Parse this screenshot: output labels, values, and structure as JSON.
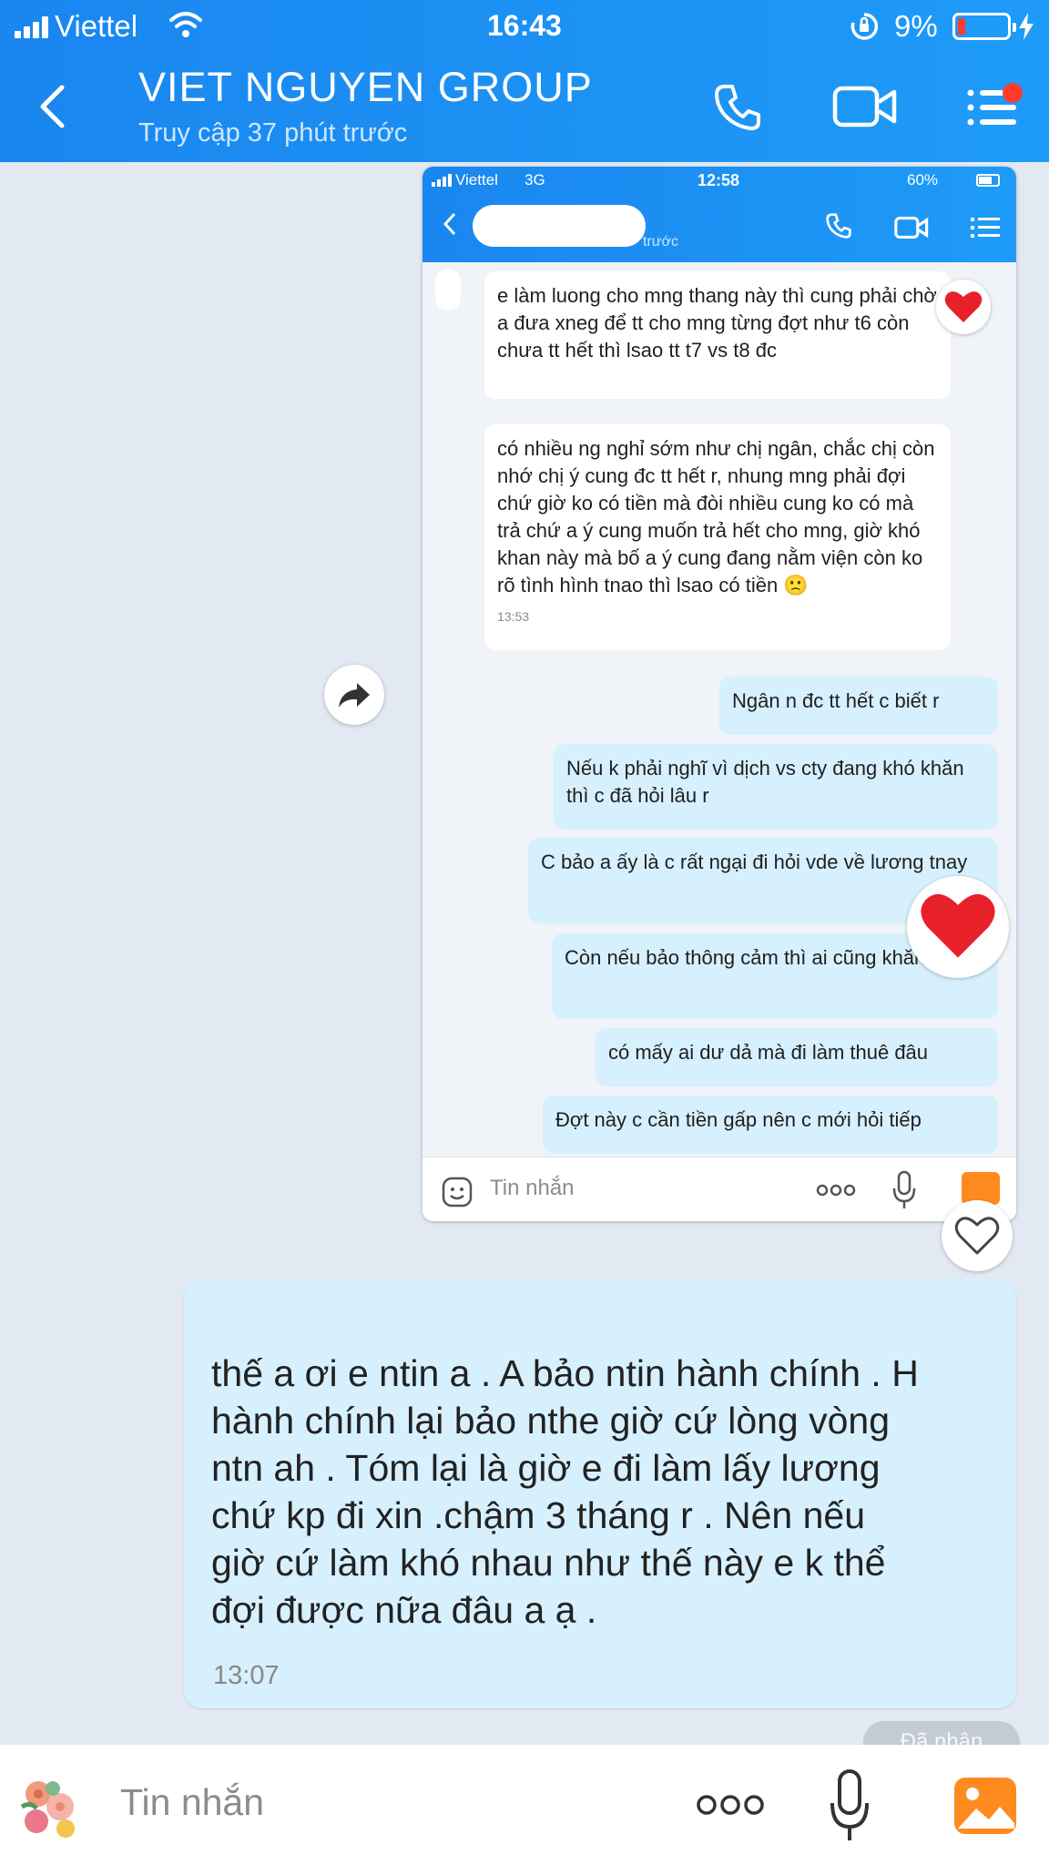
{
  "status": {
    "carrier": "Viettel",
    "time": "16:43",
    "battery": "9%"
  },
  "header": {
    "title": "VIET NGUYEN GROUP",
    "subtitle": "Truy cập 37 phút trước"
  },
  "embedded": {
    "status": {
      "carrier": "Viettel",
      "network": "3G",
      "time": "12:58",
      "battery": "60%"
    },
    "header_subtitle_visible": "trước",
    "messages": [
      {
        "side": "in",
        "text": "e làm luong cho mng thang này thì cung phải chờ a đưa xneg để tt cho mng từng đợt như t6 còn chưa tt hết thì lsao tt t7 vs t8 đc"
      },
      {
        "side": "in",
        "text": "có nhiều ng nghỉ sớm như chị ngân, chắc chị còn nhớ chị ý cung đc tt hết r, nhung mng phải đợi chứ giờ ko có tiền mà đòi nhiều cung ko có mà trả chứ a ý cung muốn trả hết cho mng, giờ khó khan này mà bố a ý cung đang nằm viện còn ko rõ tình hình tnao thì lsao có tiền 🙁",
        "time": "13:53"
      },
      {
        "side": "out",
        "text": "Ngân n đc tt hết c biết r"
      },
      {
        "side": "out",
        "text": "Nếu k phải nghĩ vì dịch vs cty đang khó khăn thì c đã hỏi lâu r"
      },
      {
        "side": "out",
        "text": "C bảo a ấy là c rất ngại đi hỏi vde về lương tnay"
      },
      {
        "side": "out",
        "text": "Còn nếu bảo thông cảm thì ai cũng khăn hết"
      },
      {
        "side": "out",
        "text": "có mấy ai dư dả mà đi làm thuê đâu"
      },
      {
        "side": "out",
        "text": "Đợt này c cần tiền gấp nên c mới hỏi tiếp"
      }
    ],
    "input_placeholder": "Tin nhắn"
  },
  "message": {
    "text": "thế a ơi e ntin a . A bảo ntin hành chính . H\nhành chính lại bảo nthe giờ cứ lòng vòng\nntn ah . Tóm lại là giờ e đi làm lấy lương\nchứ kp đi xin .chậm 3 tháng r .  Nên nếu\ngiờ cứ làm khó nhau như thế này e k thể\nđợi được nữa đâu a ạ .",
    "time": "13:07",
    "received_label": "Đã nhận"
  },
  "input": {
    "placeholder": "Tin nhắn"
  },
  "colors": {
    "header": "#1a86ef",
    "outgoing_bubble": "#d7f0fd",
    "incoming_bubble": "#ffffff",
    "heart": "#e8202a"
  },
  "icons": [
    "back-icon",
    "phone-icon",
    "video-icon",
    "menu-icon",
    "share-icon",
    "heart-reaction-icon",
    "heart-outline-icon",
    "sticker-icon",
    "more-icon",
    "mic-icon",
    "image-icon"
  ]
}
